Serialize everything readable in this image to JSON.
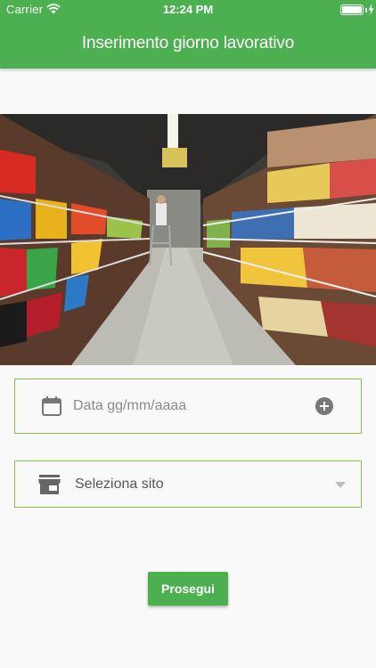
{
  "status_bar": {
    "carrier": "Carrier",
    "time": "12:24 PM",
    "icons": [
      "wifi-icon",
      "battery-icon",
      "charging-bolt-icon"
    ]
  },
  "app_bar": {
    "title": "Inserimento giorno lavorativo",
    "color": "#4caf50"
  },
  "hero_image": {
    "icon": "supermarket-aisle-photo"
  },
  "form": {
    "date_field": {
      "placeholder": "Data gg/mm/aaaa",
      "leading_icon": "calendar-icon",
      "trailing_icon": "add-circle-icon"
    },
    "site_select": {
      "label": "Seleziona sito",
      "leading_icon": "store-icon",
      "trailing_icon": "dropdown-arrow-icon"
    },
    "field_border_color": "#8bc34a"
  },
  "submit_button": {
    "label": "Prosegui"
  }
}
